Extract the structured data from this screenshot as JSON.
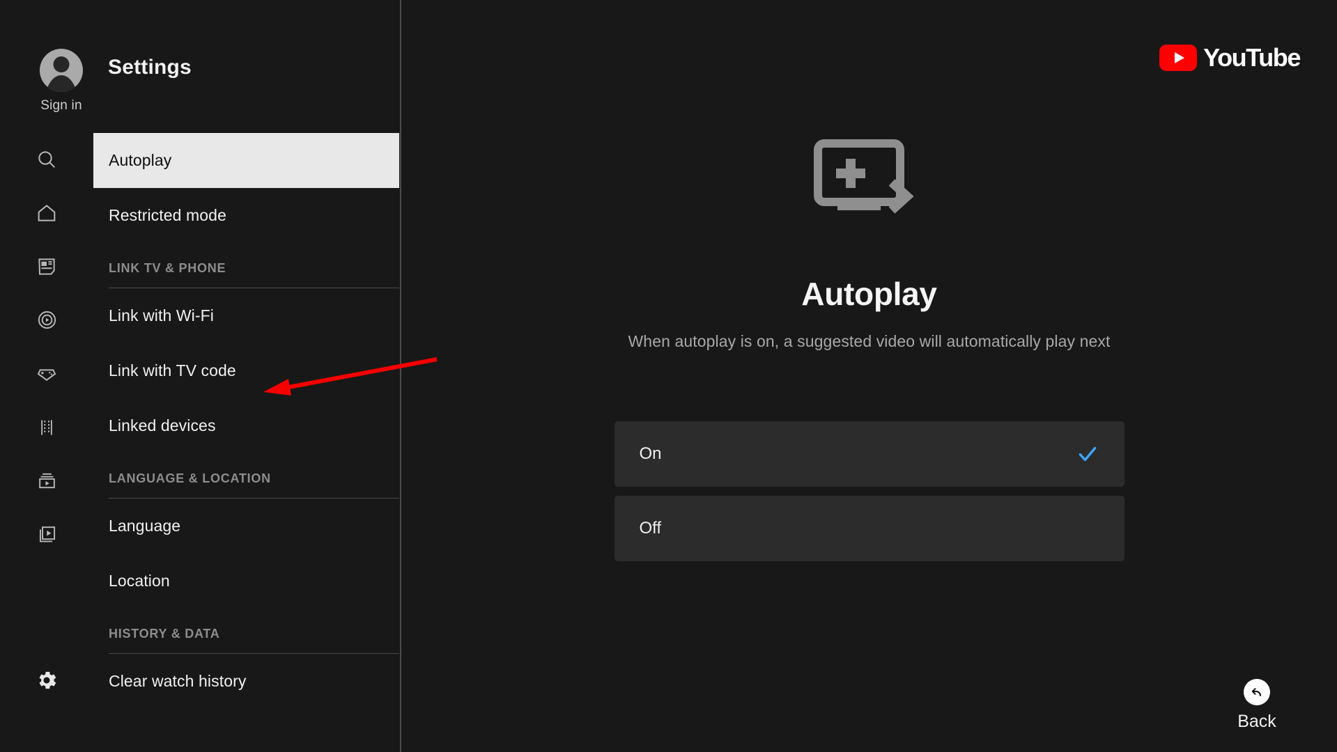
{
  "app": {
    "brand_name": "YouTube",
    "brand_color": "#ff0000",
    "accent_check_color": "#3ea6ff",
    "background_color": "#181818",
    "selected_row_color": "#e8e8e8",
    "option_row_color": "#2c2c2c"
  },
  "header": {
    "title": "Settings",
    "account_label": "Sign in"
  },
  "rail": {
    "items": [
      {
        "icon": "search-icon"
      },
      {
        "icon": "home-icon"
      },
      {
        "icon": "news-icon"
      },
      {
        "icon": "play-circle-icon"
      },
      {
        "icon": "gaming-icon"
      },
      {
        "icon": "film-strip-icon"
      },
      {
        "icon": "subscriptions-icon"
      },
      {
        "icon": "library-icon"
      }
    ],
    "settings_icon": "gear-icon"
  },
  "menu": {
    "items": [
      {
        "label": "Autoplay",
        "selected": true
      },
      {
        "label": "Restricted mode",
        "selected": false
      }
    ],
    "sections": [
      {
        "label": "LINK TV & PHONE",
        "items": [
          {
            "label": "Link with Wi-Fi"
          },
          {
            "label": "Link with TV code"
          },
          {
            "label": "Linked devices"
          }
        ]
      },
      {
        "label": "LANGUAGE & LOCATION",
        "items": [
          {
            "label": "Language"
          },
          {
            "label": "Location"
          }
        ]
      },
      {
        "label": "HISTORY & DATA",
        "items": [
          {
            "label": "Clear watch history"
          }
        ]
      }
    ]
  },
  "panel": {
    "icon": "autoplay-screen-icon",
    "title": "Autoplay",
    "description": "When autoplay is on, a suggested video will automatically play next",
    "options": [
      {
        "label": "On",
        "selected": true
      },
      {
        "label": "Off",
        "selected": false
      }
    ]
  },
  "back": {
    "label": "Back",
    "icon": "back-arrow-icon"
  },
  "annotation": {
    "type": "arrow",
    "color": "#f50000",
    "points_to": "Link with TV code"
  }
}
